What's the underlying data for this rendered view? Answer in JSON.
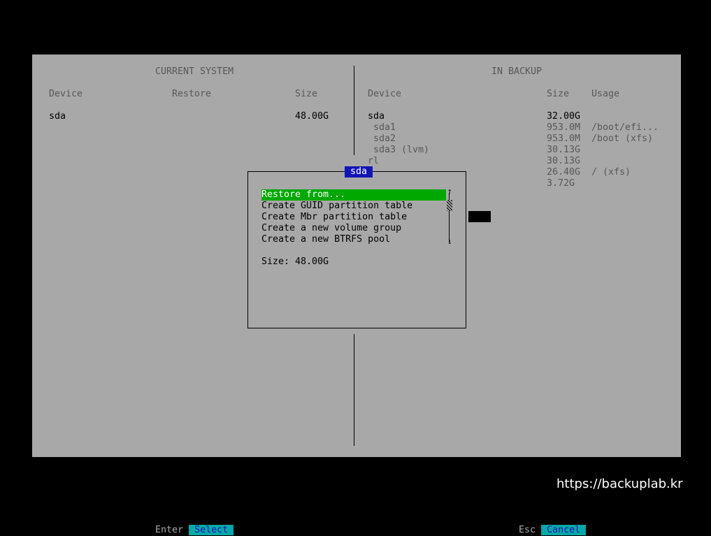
{
  "current_system": {
    "header": "CURRENT SYSTEM",
    "columns": {
      "device": "Device",
      "restore": "Restore",
      "size": "Size"
    },
    "rows": [
      {
        "device": "sda",
        "restore": "",
        "size": "48.00G"
      }
    ]
  },
  "in_backup": {
    "header": "IN BACKUP",
    "columns": {
      "device": "Device",
      "size": "Size",
      "usage": "Usage"
    },
    "rows": [
      {
        "device": "sda",
        "size": "32.00G",
        "usage": ""
      },
      {
        "device": " sda1",
        "size": "953.0M",
        "usage": "/boot/efi..."
      },
      {
        "device": " sda2",
        "size": "953.0M",
        "usage": "/boot (xfs)"
      },
      {
        "device": " sda3 (lvm)",
        "size": "30.13G",
        "usage": ""
      },
      {
        "device": "rl",
        "size": "30.13G",
        "usage": ""
      },
      {
        "device": "",
        "size": "26.40G",
        "usage": "/ (xfs)"
      },
      {
        "device": "",
        "size": "3.72G",
        "usage": ""
      }
    ]
  },
  "dialog": {
    "title": "sda",
    "menu": [
      "Restore from...",
      "Create GUID partition table",
      "Create Mbr partition table",
      "Create a new volume group",
      "Create a new BTRFS pool"
    ],
    "selected_index": 0,
    "info": "Size: 48.00G",
    "scroll_up": "↑",
    "scroll_down": "↓"
  },
  "footer": {
    "left_key": "Enter",
    "left_action": "Select",
    "right_key": "Esc",
    "right_action": "Cancel"
  },
  "watermark": "https://backuplab.kr",
  "colors": {
    "screen_bg": "#a8a8a8",
    "selection": "#00a800",
    "title_bg": "#1414b4",
    "footer_button": "#00a8a8"
  }
}
